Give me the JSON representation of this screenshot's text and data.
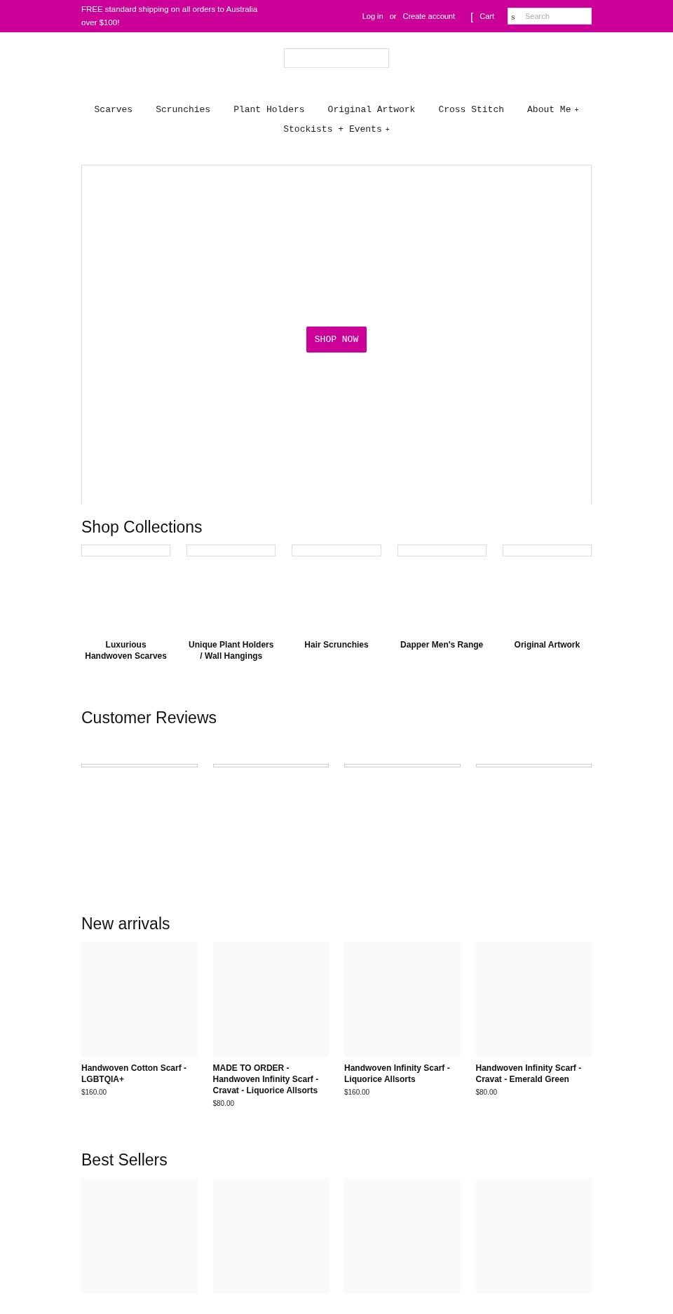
{
  "top_bar": {
    "announcement": "FREE standard shipping on all orders to Australia over $100!",
    "login": "Log in",
    "separator": "or",
    "create_account": "Create account",
    "cart_glyph": "[",
    "cart": "Cart",
    "search_glyph": "s",
    "search_placeholder": "Search"
  },
  "nav": [
    {
      "label": "Scarves",
      "has_dropdown": false
    },
    {
      "label": "Scrunchies",
      "has_dropdown": false
    },
    {
      "label": "Plant Holders",
      "has_dropdown": false
    },
    {
      "label": "Original Artwork",
      "has_dropdown": false
    },
    {
      "label": "Cross Stitch",
      "has_dropdown": false
    },
    {
      "label": "About Me",
      "has_dropdown": true,
      "dropdown_glyph": "+"
    },
    {
      "label": "Stockists + Events",
      "has_dropdown": true,
      "dropdown_glyph": "+"
    }
  ],
  "hero": {
    "button": "SHOP NOW"
  },
  "collections": {
    "title": "Shop Collections",
    "items": [
      "Luxurious Handwoven Scarves",
      "Unique Plant Holders / Wall Hangings",
      "Hair Scrunchies",
      "Dapper Men's Range",
      "Original Artwork"
    ]
  },
  "reviews": {
    "title": "Customer Reviews"
  },
  "new_arrivals": {
    "title": "New arrivals",
    "products": [
      {
        "name": "Handwoven Cotton Scarf - LGBTQIA+",
        "price": "$160.00"
      },
      {
        "name": "MADE TO ORDER - Handwoven Infinity Scarf - Cravat - Liquorice Allsorts",
        "price": "$80.00"
      },
      {
        "name": "Handwoven Infinity Scarf - Liquorice Allsorts",
        "price": "$160.00"
      },
      {
        "name": "Handwoven Infinity Scarf - Cravat - Emerald Green",
        "price": "$80.00"
      }
    ]
  },
  "best_sellers": {
    "title": "Best Sellers"
  }
}
